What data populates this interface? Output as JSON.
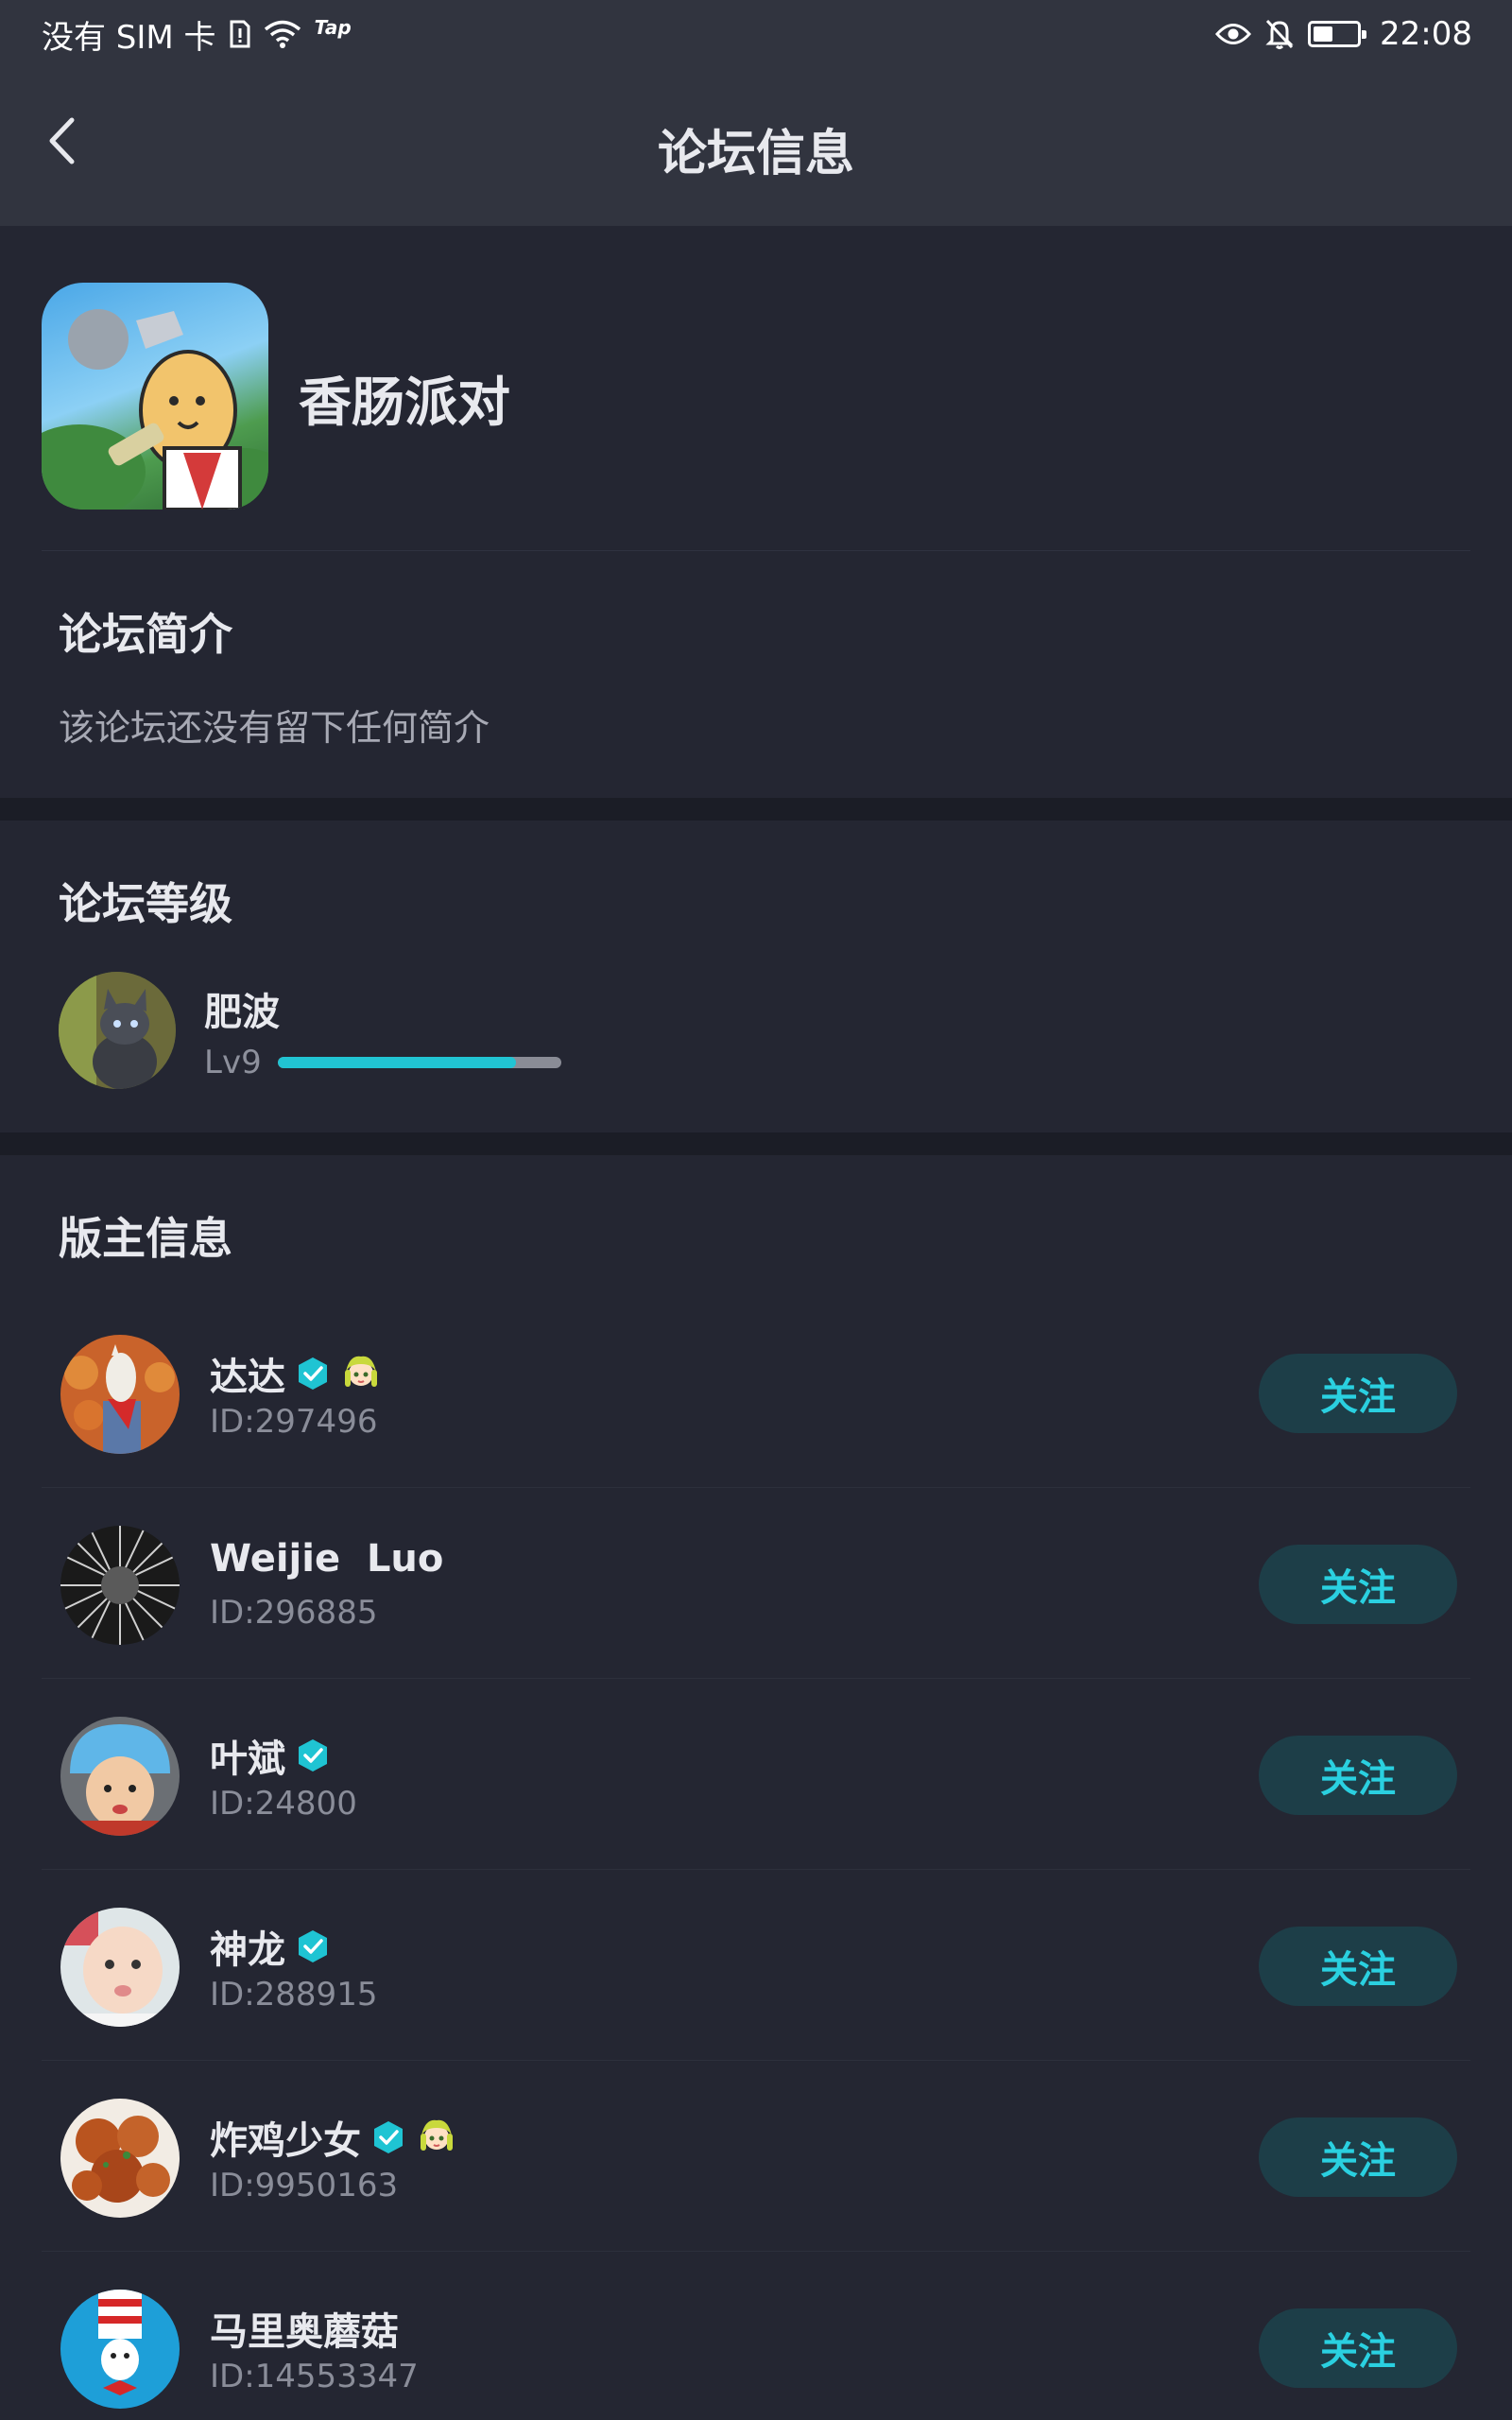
{
  "status_bar": {
    "carrier": "没有 SIM 卡",
    "tap_tag": "Tap",
    "time": "22:08",
    "battery_level_fraction": 0.4
  },
  "header": {
    "title": "论坛信息"
  },
  "forum": {
    "name": "香肠派对",
    "intro_title": "论坛简介",
    "intro_text": "该论坛还没有留下任何简介"
  },
  "level": {
    "title": "论坛等级",
    "user_name": "肥波",
    "level_label": "Lv9",
    "progress_fraction": 0.84
  },
  "moderators": {
    "title": "版主信息",
    "follow_label": "关注",
    "items": [
      {
        "name": "达达",
        "id": "ID:297496",
        "verified": true,
        "badge": true
      },
      {
        "name": "Weijie  Luo",
        "id": "ID:296885",
        "verified": false,
        "badge": false
      },
      {
        "name": "叶斌",
        "id": "ID:24800",
        "verified": true,
        "badge": false
      },
      {
        "name": "神龙",
        "id": "ID:288915",
        "verified": true,
        "badge": false
      },
      {
        "name": "炸鸡少女",
        "id": "ID:9950163",
        "verified": true,
        "badge": true
      },
      {
        "name": "马里奥蘑菇",
        "id": "ID:14553347",
        "verified": false,
        "badge": false
      }
    ]
  },
  "colors": {
    "accent": "#21c4d3",
    "follow_bg": "#1d3e48",
    "background": "#242632",
    "header_bg": "#31343f"
  }
}
